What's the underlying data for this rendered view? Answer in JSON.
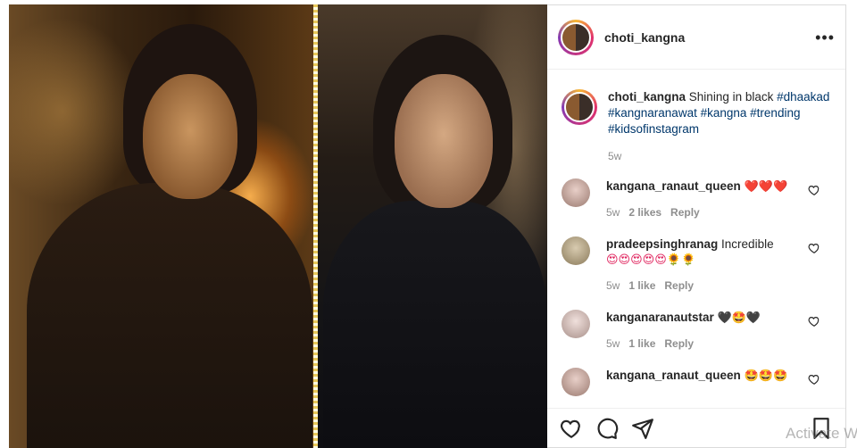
{
  "post": {
    "username": "choti_kangna",
    "more_label": "•••",
    "caption": {
      "username": "choti_kangna",
      "text": "Shining in black",
      "hashtags": [
        "#dhaakad",
        "#kangnaranawat",
        "#kangna",
        "#trending",
        "#kidsofinstagram"
      ],
      "age": "5w"
    }
  },
  "comments": [
    {
      "username": "kangana_ranaut_queen",
      "text": "",
      "emojis": "❤️❤️❤️",
      "age": "5w",
      "likes": "2 likes",
      "reply": "Reply",
      "avatar_color": "#c9a5a0"
    },
    {
      "username": "pradeepsinghranag",
      "text": "Incredible",
      "emojis": "😍😍😍😍😍🌻🌻",
      "age": "5w",
      "likes": "1 like",
      "reply": "Reply",
      "avatar_color": "#b8a88a"
    },
    {
      "username": "kanganaranautstar",
      "text": "",
      "emojis": "🖤🤩🖤",
      "age": "5w",
      "likes": "1 like",
      "reply": "Reply",
      "avatar_color": "#d8c0b8"
    },
    {
      "username": "kangana_ranaut_queen",
      "text": "",
      "emojis": "🤩🤩🤩",
      "age": "",
      "likes": "",
      "reply": "",
      "avatar_color": "#c9a5a0"
    }
  ],
  "watermark": "Activate W"
}
